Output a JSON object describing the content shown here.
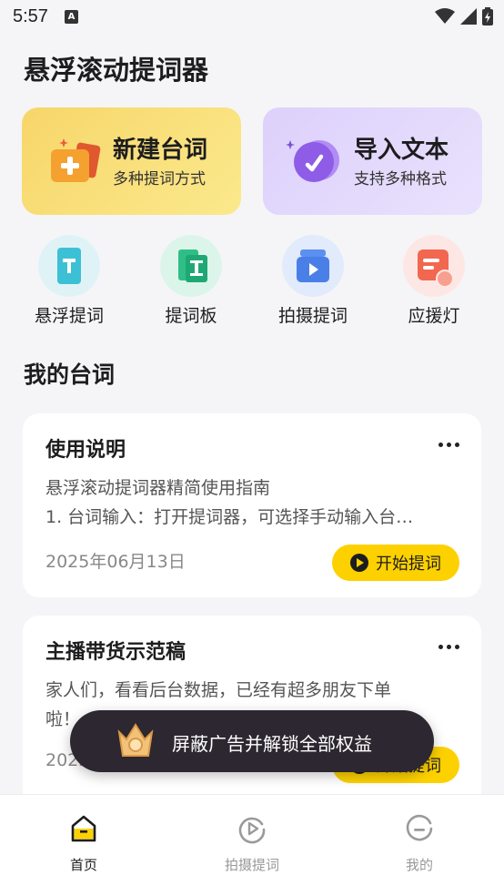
{
  "status_bar": {
    "time": "5:57"
  },
  "page_title": "悬浮滚动提词器",
  "cards": {
    "new": {
      "title": "新建台词",
      "subtitle": "多种提词方式",
      "icon": "plus-icon"
    },
    "import": {
      "title": "导入文本",
      "subtitle": "支持多种格式",
      "icon": "import-check-icon"
    }
  },
  "quick_actions": [
    {
      "label": "悬浮提词",
      "icon": "floating-text-icon",
      "color": "#dff3f7"
    },
    {
      "label": "提词板",
      "icon": "prompt-board-icon",
      "color": "#dcf5ea"
    },
    {
      "label": "拍摄提词",
      "icon": "camera-prompt-icon",
      "color": "#e2ebfb"
    },
    {
      "label": "应援灯",
      "icon": "cheer-light-icon",
      "color": "#fde7e4"
    }
  ],
  "section_title": "我的台词",
  "scripts": [
    {
      "title": "使用说明",
      "lines": [
        "悬浮滚动提词器精简使用指南",
        "1. 台词输入：打开提词器，可选择手动输入台…"
      ],
      "date": "2025年06月13日",
      "action": "开始提词"
    },
    {
      "title": "主播带货示范稿",
      "lines": [
        "家人们，看看后台数据，已经有超多朋友下单",
        "啦！..."
      ],
      "date": "2025",
      "action": "开始提词"
    }
  ],
  "ad_banner": {
    "text": "屏蔽广告并解锁全部权益"
  },
  "tabs": [
    {
      "label": "首页",
      "icon": "home-icon",
      "active": true
    },
    {
      "label": "拍摄提词",
      "icon": "play-circle-icon",
      "active": false
    },
    {
      "label": "我的",
      "icon": "profile-icon",
      "active": false
    }
  ],
  "colors": {
    "accent_yellow": "#fdd100",
    "background": "#f5f5f7"
  }
}
